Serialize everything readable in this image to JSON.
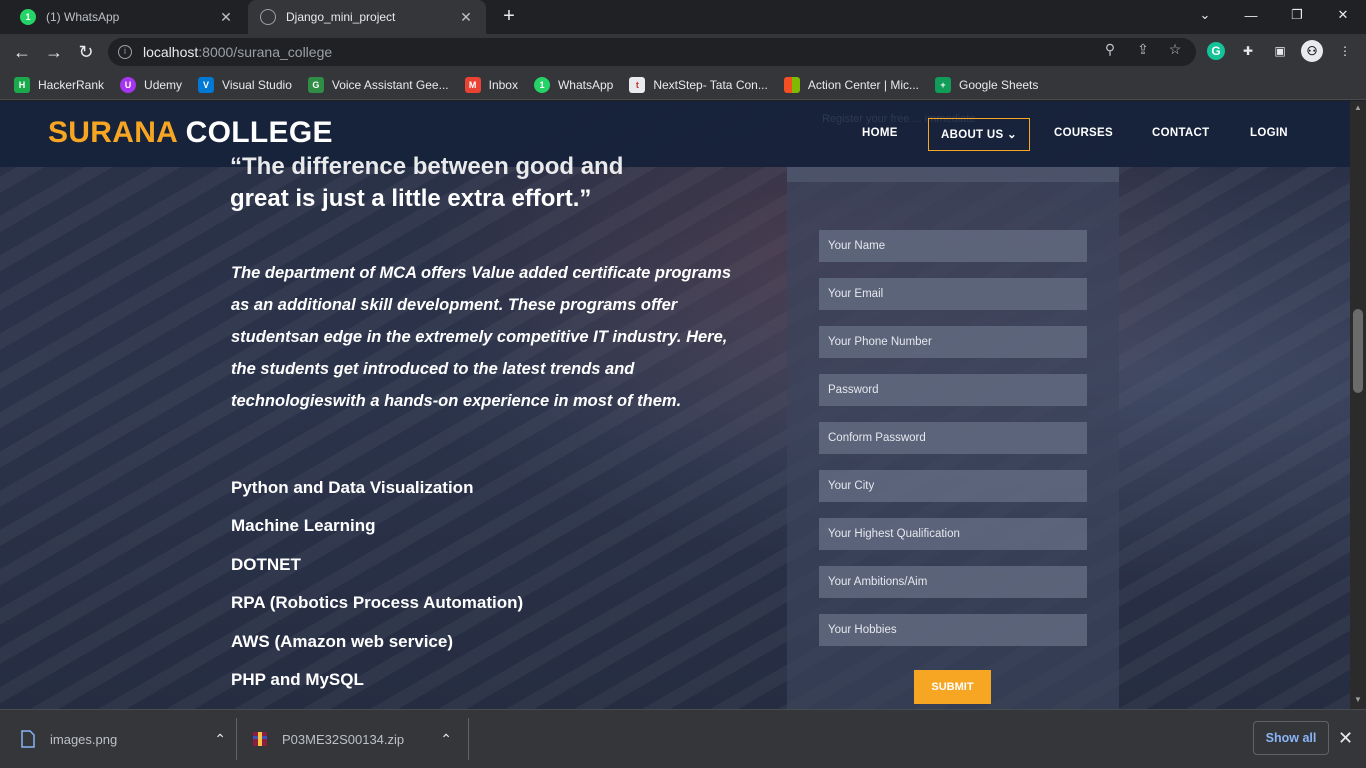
{
  "browser": {
    "tabs": [
      {
        "title": "(1) WhatsApp",
        "active": false,
        "icon": "whatsapp-icon"
      },
      {
        "title": "Django_mini_project",
        "active": true,
        "icon": "globe-icon"
      }
    ],
    "url_host": "localhost",
    "url_rest": ":8000/surana_college",
    "bookmarks": [
      {
        "label": "HackerRank",
        "icon": "hackerrank-icon",
        "color": "#1ba94c",
        "glyph": "H"
      },
      {
        "label": "Udemy",
        "icon": "udemy-icon",
        "color": "#a435f0",
        "glyph": "U"
      },
      {
        "label": "Visual Studio",
        "icon": "visual-studio-icon",
        "color": "#0078d4",
        "glyph": "V"
      },
      {
        "label": "Voice Assistant Gee...",
        "icon": "geeksforgeeks-icon",
        "color": "#2f8d46",
        "glyph": "G"
      },
      {
        "label": "Inbox",
        "icon": "gmail-icon",
        "color": "#ea4335",
        "glyph": "M"
      },
      {
        "label": "WhatsApp",
        "icon": "whatsapp-icon",
        "color": "#25d366",
        "glyph": "W"
      },
      {
        "label": "NextStep- Tata Con...",
        "icon": "tcs-icon",
        "color": "#e8eaed",
        "glyph": "t"
      },
      {
        "label": "Action Center | Mic...",
        "icon": "microsoft-icon",
        "color": "#f25022",
        "glyph": "■"
      },
      {
        "label": "Google Sheets",
        "icon": "google-sheets-icon",
        "color": "#0f9d58",
        "glyph": "+"
      }
    ]
  },
  "site": {
    "logo_part1": "SURANA",
    "logo_part2": "COLLEGE",
    "nav": {
      "home": "HOME",
      "about": "ABOUT US",
      "courses": "COURSES",
      "contact": "CONTACT",
      "login": "LOGIN"
    },
    "ghost_line1": "Register your free ... immediate",
    "quote_line1": "“The difference between good and",
    "quote_line2": "great is just a little extra effort.”",
    "description": "The department of MCA offers Value added certificate programs as an additional skill development. These programs offer studentsan edge in the extremely competitive IT industry. Here, the students get introduced to the latest trends and technologieswith a hands-on experience in most of them.",
    "courses": [
      "Python and Data Visualization",
      "Machine Learning",
      "DOTNET",
      "RPA (Robotics Process Automation)",
      "AWS (Amazon web service)",
      "PHP and MySQL"
    ],
    "form": {
      "name_placeholder": "Your Name",
      "email_placeholder": "Your Email",
      "phone_placeholder": "Your Phone Number",
      "password_placeholder": "Password",
      "confirm_placeholder": "Conform Password",
      "city_placeholder": "Your City",
      "qualification_placeholder": "Your Highest Qualification",
      "ambitions_placeholder": "Your Ambitions/Aim",
      "hobbies_placeholder": "Your Hobbies",
      "submit_label": "SUBMIT"
    },
    "accent_color": "#f6a623"
  },
  "downloads": {
    "items": [
      {
        "name": "images.png",
        "icon": "file-icon"
      },
      {
        "name": "P03ME32S00134.zip",
        "icon": "zip-archive-icon"
      }
    ],
    "show_all": "Show all"
  }
}
